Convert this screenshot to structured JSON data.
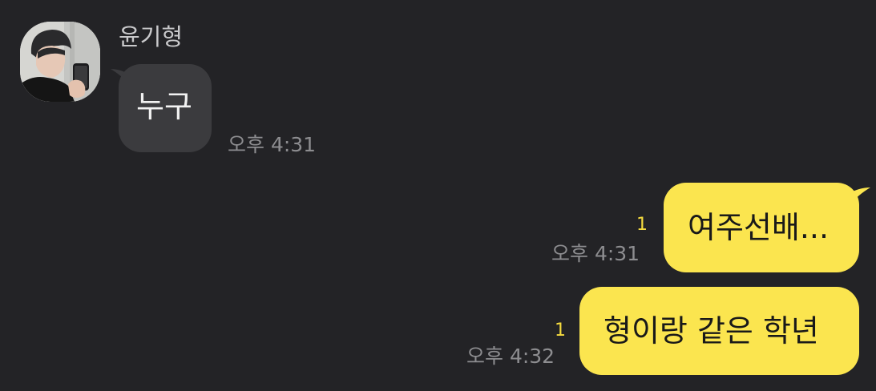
{
  "chat": {
    "sender": {
      "name": "윤기형",
      "avatar_icon": "profile-photo"
    },
    "messages": [
      {
        "direction": "incoming",
        "text": "누구",
        "time": "오후 4:31",
        "unread": ""
      },
      {
        "direction": "outgoing",
        "text": "여주선배...",
        "time": "오후 4:31",
        "unread": "1"
      },
      {
        "direction": "outgoing",
        "text": "형이랑 같은 학년",
        "time": "오후 4:32",
        "unread": "1"
      }
    ]
  },
  "colors": {
    "background": "#232326",
    "incoming_bubble": "#3b3b3e",
    "outgoing_bubble": "#fbe54f",
    "unread_count": "#f6dc3f",
    "timestamp": "#8d8d90"
  }
}
